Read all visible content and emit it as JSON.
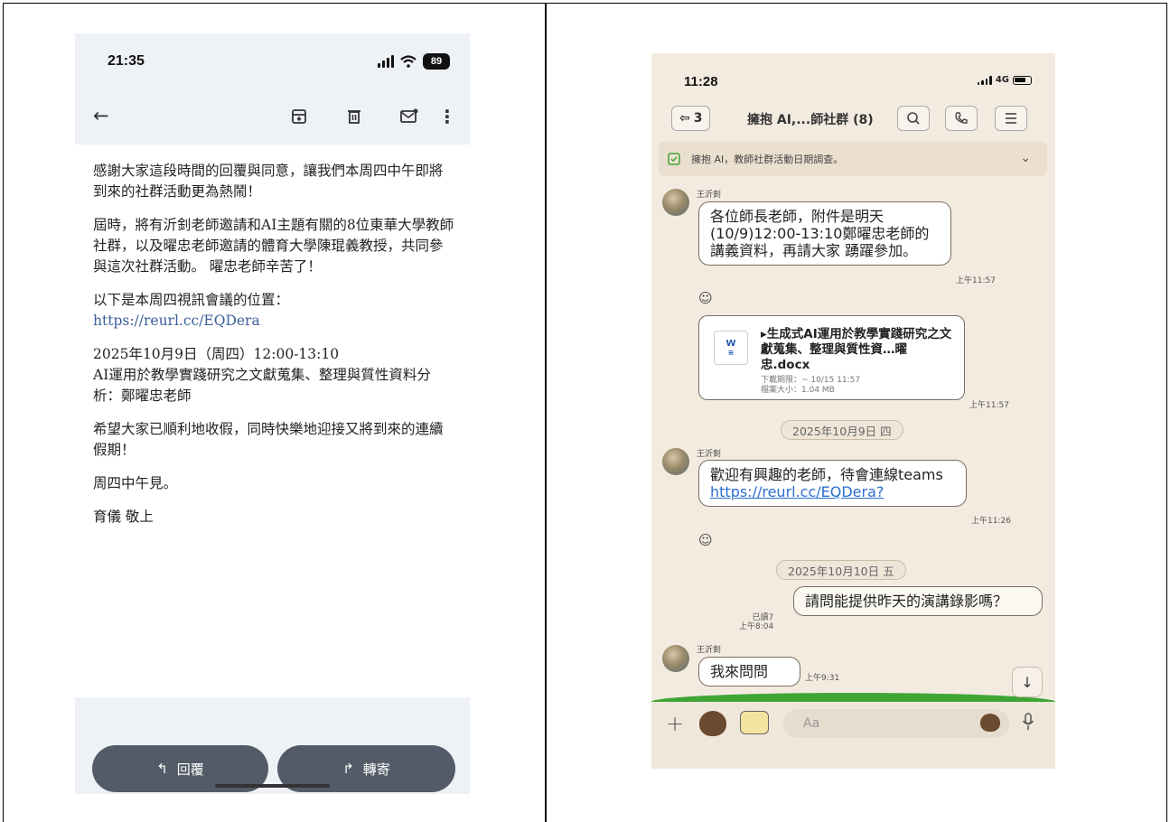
{
  "gmail": {
    "status": {
      "time": "21:35",
      "battery": "89"
    },
    "toolbar": {
      "back": "back-arrow-icon",
      "archive": "archive-icon",
      "delete": "trash-icon",
      "unread": "mark-unread-icon",
      "more": "more-vert-icon"
    },
    "paragraphs": [
      "感謝大家這段時間的回覆與同意，讓我們本周四中午即將到來的社群活動更為熱鬧！",
      "屆時，將有沂釗老師邀請和AI主題有關的8位東華大學教師社群，以及曜忠老師邀請的體育大學陳琨義教授，共同參與這次社群活動。 曜忠老師辛苦了！",
      "以下是本周四視訊會議的位置："
    ],
    "link": "https://reurl.cc/EQDera",
    "event_line1": "2025年10月9日（周四）12:00-13:10",
    "event_line2": "AI運用於教學實踐研究之文獻蒐集、整理與質性資料分析：鄭曜忠老師",
    "wish": "希望大家已順利地收假，同時快樂地迎接又將到來的連續假期！",
    "see_you": "周四中午見。",
    "signature": "育儀 敬上",
    "reply_label": "回覆",
    "forward_label": "轉寄"
  },
  "line": {
    "status": {
      "time": "11:28",
      "network": "4G"
    },
    "header": {
      "back_count": "3",
      "title": "擁抱 AI,...師社群 (8)"
    },
    "notice": "擁抱 AI，教師社群活動日期調查。",
    "messages": {
      "m1_sender": "王沂釗",
      "m1_text": "各位師長老師，附件是明天(10/9)12:00-13:10鄭曜忠老師的講義資料，再請大家 踴躍參加。",
      "m1_time": "上午11:57",
      "file_name": "▸生成式AI運用於教學實踐研究之文獻蒐集、整理與質性資…曜忠.docx",
      "file_expiry": "下載期限：~ 10/15 11:57",
      "file_size": "檔案大小：1.04 MB",
      "file_time": "上午11:57",
      "date1": "2025年10月9日 四",
      "m2_sender": "王沂釗",
      "m2_text": "歡迎有興趣的老師，待會連線teams",
      "m2_link": "https://reurl.cc/EQDera?",
      "m2_time": "上午11:26",
      "date2": "2025年10月10日 五",
      "m3_text": "請問能提供昨天的演講錄影嗎？",
      "m3_read": "已讀7",
      "m3_time": "上午8:04",
      "m4_sender": "王沂釗",
      "m4_text": "我來問問",
      "m4_time": "上午9:31"
    },
    "input_placeholder": "Aa"
  }
}
